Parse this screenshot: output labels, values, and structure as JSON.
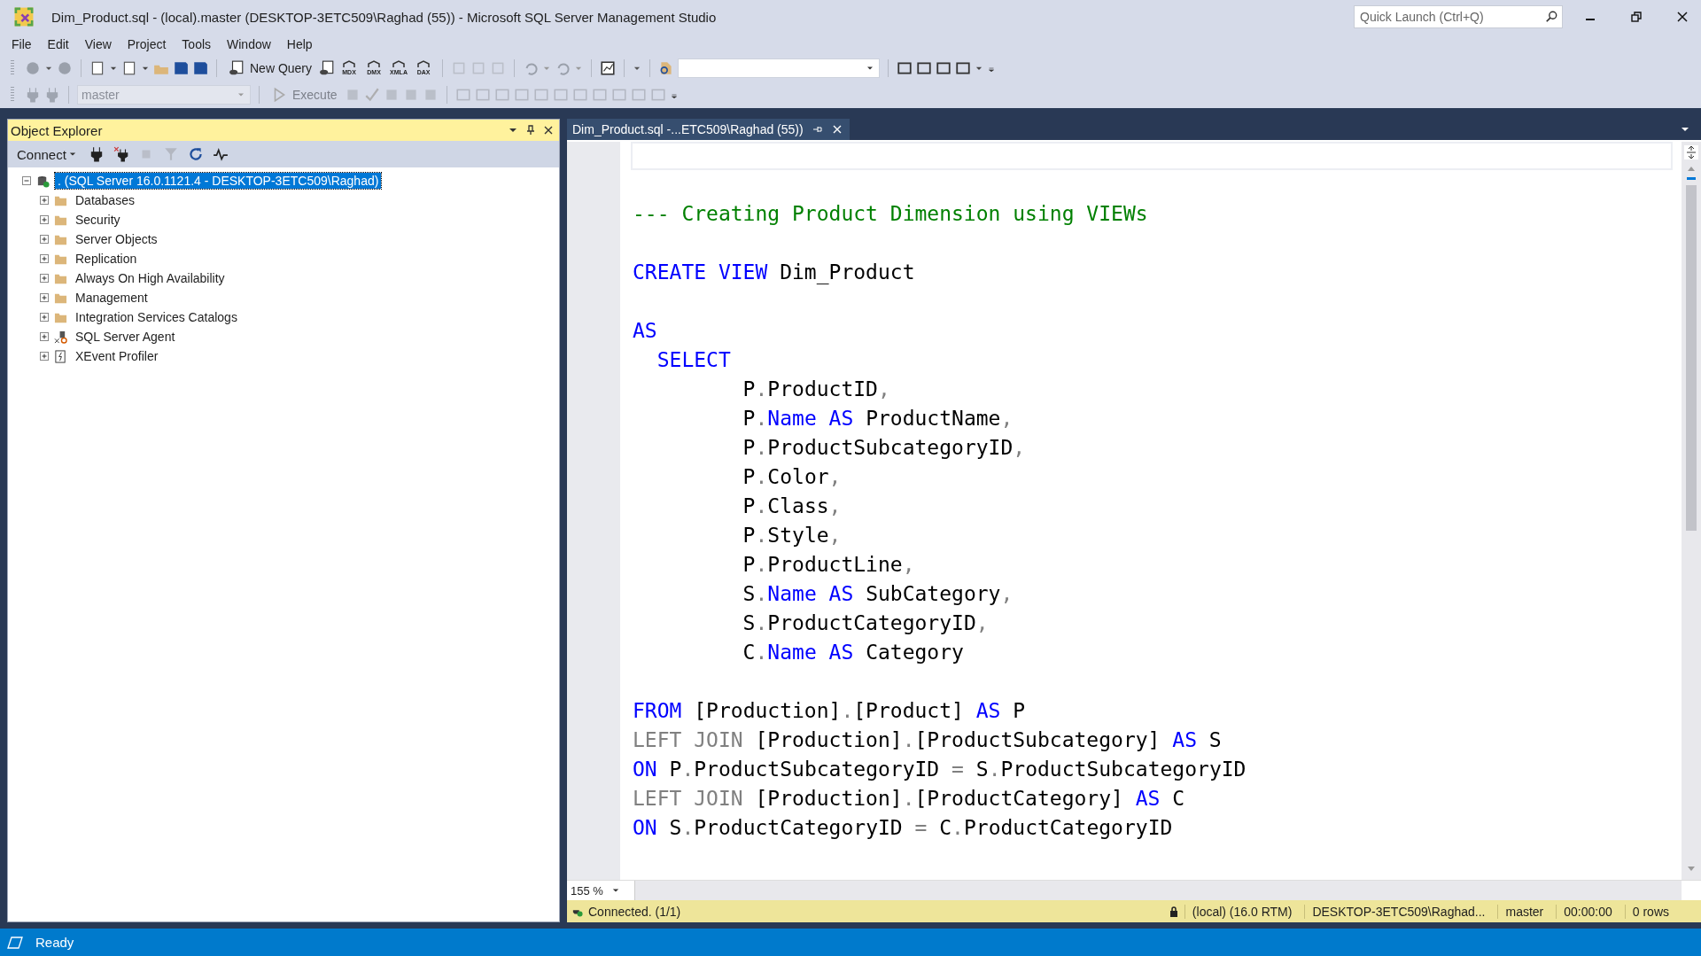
{
  "window": {
    "title": "Dim_Product.sql - (local).master (DESKTOP-3ETC509\\Raghad (55)) - Microsoft SQL Server Management Studio",
    "quick_launch": {
      "placeholder": "Quick Launch (Ctrl+Q)"
    }
  },
  "menu": [
    "File",
    "Edit",
    "View",
    "Project",
    "Tools",
    "Window",
    "Help"
  ],
  "toolbar": {
    "new_query": "New Query",
    "query_types": [
      "MDX",
      "DMX",
      "XMLA",
      "DAX"
    ],
    "database": {
      "value": "master",
      "disabled": true
    },
    "execute": {
      "label": "Execute",
      "disabled": true
    }
  },
  "object_explorer": {
    "title": "Object Explorer",
    "connect": "Connect",
    "tree": [
      {
        "label": ". (SQL Server 16.0.1121.4 - DESKTOP-3ETC509\\Raghad)",
        "kind": "server",
        "expanded": true,
        "selected": true,
        "children": [
          {
            "label": "Databases",
            "kind": "folder",
            "expanded": false,
            "selected": false
          },
          {
            "label": "Security",
            "kind": "folder",
            "expanded": false,
            "selected": false
          },
          {
            "label": "Server Objects",
            "kind": "folder",
            "expanded": false,
            "selected": false
          },
          {
            "label": "Replication",
            "kind": "folder",
            "expanded": false,
            "selected": false
          },
          {
            "label": "Always On High Availability",
            "kind": "folder",
            "expanded": false,
            "selected": false
          },
          {
            "label": "Management",
            "kind": "folder",
            "expanded": false,
            "selected": false
          },
          {
            "label": "Integration Services Catalogs",
            "kind": "folder",
            "expanded": false,
            "selected": false
          },
          {
            "label": "SQL Server Agent",
            "kind": "agent",
            "expanded": false,
            "selected": false
          },
          {
            "label": "XEvent Profiler",
            "kind": "xevent",
            "expanded": false,
            "selected": false
          }
        ]
      }
    ]
  },
  "editor": {
    "tab": {
      "title": "Dim_Product.sql -...ETC509\\Raghad (55))"
    },
    "code": [
      [
        [
          {
            "text": "--- Creating Product Dimension using VIEWs",
            "kind": "comment"
          }
        ]
      ],
      [
        [
          {
            "text": "CREATE VIEW",
            "kind": "keyword"
          },
          {
            "text": " Dim_Product",
            "kind": "plain"
          }
        ]
      ],
      [
        [
          {
            "text": "AS",
            "kind": "keyword"
          }
        ],
        [
          {
            "text": "  SELECT",
            "kind": "keyword"
          }
        ],
        [
          {
            "text": "         P",
            "kind": "plain"
          },
          {
            "text": ".",
            "kind": "operator"
          },
          {
            "text": "ProductID",
            "kind": "plain"
          },
          {
            "text": ",",
            "kind": "operator"
          }
        ],
        [
          {
            "text": "         P",
            "kind": "plain"
          },
          {
            "text": ".",
            "kind": "operator"
          },
          {
            "text": "Name AS",
            "kind": "keyword"
          },
          {
            "text": " ProductName",
            "kind": "plain"
          },
          {
            "text": ",",
            "kind": "operator"
          }
        ],
        [
          {
            "text": "         P",
            "kind": "plain"
          },
          {
            "text": ".",
            "kind": "operator"
          },
          {
            "text": "ProductSubcategoryID",
            "kind": "plain"
          },
          {
            "text": ",",
            "kind": "operator"
          }
        ],
        [
          {
            "text": "         P",
            "kind": "plain"
          },
          {
            "text": ".",
            "kind": "operator"
          },
          {
            "text": "Color",
            "kind": "plain"
          },
          {
            "text": ",",
            "kind": "operator"
          }
        ],
        [
          {
            "text": "         P",
            "kind": "plain"
          },
          {
            "text": ".",
            "kind": "operator"
          },
          {
            "text": "Class",
            "kind": "plain"
          },
          {
            "text": ",",
            "kind": "operator"
          }
        ],
        [
          {
            "text": "         P",
            "kind": "plain"
          },
          {
            "text": ".",
            "kind": "operator"
          },
          {
            "text": "Style",
            "kind": "plain"
          },
          {
            "text": ",",
            "kind": "operator"
          }
        ],
        [
          {
            "text": "         P",
            "kind": "plain"
          },
          {
            "text": ".",
            "kind": "operator"
          },
          {
            "text": "ProductLine",
            "kind": "plain"
          },
          {
            "text": ",",
            "kind": "operator"
          }
        ],
        [
          {
            "text": "         S",
            "kind": "plain"
          },
          {
            "text": ".",
            "kind": "operator"
          },
          {
            "text": "Name AS",
            "kind": "keyword"
          },
          {
            "text": " SubCategory",
            "kind": "plain"
          },
          {
            "text": ",",
            "kind": "operator"
          }
        ],
        [
          {
            "text": "         S",
            "kind": "plain"
          },
          {
            "text": ".",
            "kind": "operator"
          },
          {
            "text": "ProductCategoryID",
            "kind": "plain"
          },
          {
            "text": ",",
            "kind": "operator"
          }
        ],
        [
          {
            "text": "         C",
            "kind": "plain"
          },
          {
            "text": ".",
            "kind": "operator"
          },
          {
            "text": "Name AS",
            "kind": "keyword"
          },
          {
            "text": " Category",
            "kind": "plain"
          }
        ]
      ],
      [
        [
          {
            "text": "FROM",
            "kind": "keyword"
          },
          {
            "text": " [Production]",
            "kind": "plain"
          },
          {
            "text": ".",
            "kind": "operator"
          },
          {
            "text": "[Product] ",
            "kind": "plain"
          },
          {
            "text": "AS",
            "kind": "keyword"
          },
          {
            "text": " P",
            "kind": "plain"
          }
        ],
        [
          {
            "text": "LEFT JOIN",
            "kind": "operator"
          },
          {
            "text": " [Production]",
            "kind": "plain"
          },
          {
            "text": ".",
            "kind": "operator"
          },
          {
            "text": "[ProductSubcategory] ",
            "kind": "plain"
          },
          {
            "text": "AS",
            "kind": "keyword"
          },
          {
            "text": " S",
            "kind": "plain"
          }
        ],
        [
          {
            "text": "ON",
            "kind": "keyword"
          },
          {
            "text": " P",
            "kind": "plain"
          },
          {
            "text": ".",
            "kind": "operator"
          },
          {
            "text": "ProductSubcategoryID ",
            "kind": "plain"
          },
          {
            "text": "=",
            "kind": "operator"
          },
          {
            "text": " S",
            "kind": "plain"
          },
          {
            "text": ".",
            "kind": "operator"
          },
          {
            "text": "ProductSubcategoryID",
            "kind": "plain"
          }
        ],
        [
          {
            "text": "LEFT JOIN",
            "kind": "operator"
          },
          {
            "text": " [Production]",
            "kind": "plain"
          },
          {
            "text": ".",
            "kind": "operator"
          },
          {
            "text": "[ProductCategory] ",
            "kind": "plain"
          },
          {
            "text": "AS",
            "kind": "keyword"
          },
          {
            "text": " C",
            "kind": "plain"
          }
        ],
        [
          {
            "text": "ON",
            "kind": "keyword"
          },
          {
            "text": " S",
            "kind": "plain"
          },
          {
            "text": ".",
            "kind": "operator"
          },
          {
            "text": "ProductCategoryID ",
            "kind": "plain"
          },
          {
            "text": "=",
            "kind": "operator"
          },
          {
            "text": " C",
            "kind": "plain"
          },
          {
            "text": ".",
            "kind": "operator"
          },
          {
            "text": "ProductCategoryID",
            "kind": "plain"
          }
        ]
      ]
    ],
    "zoom": "155 %",
    "status": {
      "connection": "Connected. (1/1)",
      "server": "(local) (16.0 RTM)",
      "user": "DESKTOP-3ETC509\\Raghad...",
      "database": "master",
      "elapsed": "00:00:00",
      "rows": "0 rows"
    }
  },
  "status_bar": {
    "text": "Ready"
  }
}
